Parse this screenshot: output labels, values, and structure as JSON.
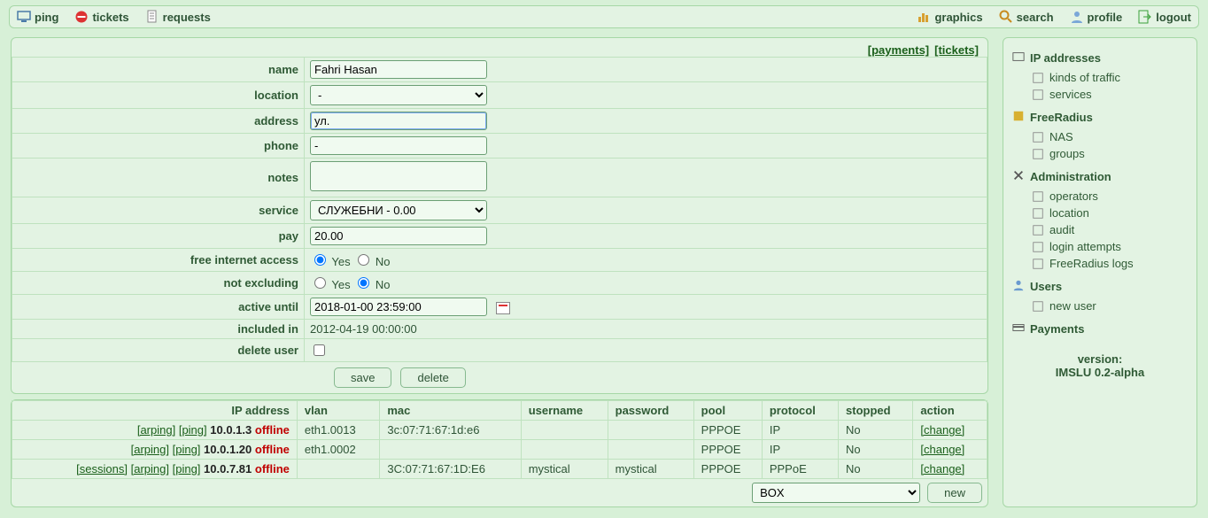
{
  "topbar": {
    "left": [
      {
        "key": "ping",
        "label": "ping"
      },
      {
        "key": "tickets",
        "label": "tickets"
      },
      {
        "key": "requests",
        "label": "requests"
      }
    ],
    "right": [
      {
        "key": "graphics",
        "label": "graphics"
      },
      {
        "key": "search",
        "label": "search"
      },
      {
        "key": "profile",
        "label": "profile"
      },
      {
        "key": "logout",
        "label": "logout"
      }
    ]
  },
  "header_links": {
    "payments": "[payments]",
    "tickets": "[tickets]"
  },
  "form": {
    "name_label": "name",
    "name_value": "Fahri Hasan",
    "location_label": "location",
    "location_value": "-",
    "address_label": "address",
    "address_value": "ул.",
    "phone_label": "phone",
    "phone_value": "-",
    "notes_label": "notes",
    "notes_value": "",
    "service_label": "service",
    "service_value": "СЛУЖЕБНИ - 0.00",
    "pay_label": "pay",
    "pay_value": "20.00",
    "free_label": "free internet access",
    "notexcl_label": "not excluding",
    "yes": "Yes",
    "no": "No",
    "active_label": "active until",
    "active_value": "2018-01-00 23:59:00",
    "included_label": "included in",
    "included_value": "2012-04-19 00:00:00",
    "delete_label": "delete user",
    "save": "save",
    "delete": "delete"
  },
  "ip_table": {
    "headers": {
      "ip": "IP address",
      "vlan": "vlan",
      "mac": "mac",
      "username": "username",
      "password": "password",
      "pool": "pool",
      "protocol": "protocol",
      "stopped": "stopped",
      "action": "action"
    },
    "links": {
      "arping": "[arping]",
      "ping": "[ping]",
      "sessions": "[sessions]",
      "change": "[change]"
    },
    "status": {
      "offline": "offline"
    },
    "rows": [
      {
        "ip": "10.0.1.3",
        "sessions": false,
        "vlan": "eth1.0013",
        "mac": "3c:07:71:67:1d:e6",
        "username": "",
        "password": "",
        "pool": "PPPOE",
        "protocol": "IP",
        "stopped": "No"
      },
      {
        "ip": "10.0.1.20",
        "sessions": false,
        "vlan": "eth1.0002",
        "mac": "",
        "username": "",
        "password": "",
        "pool": "PPPOE",
        "protocol": "IP",
        "stopped": "No"
      },
      {
        "ip": "10.0.7.81",
        "sessions": true,
        "vlan": "",
        "mac": "3C:07:71:67:1D:E6",
        "username": "mystical",
        "password": "mystical",
        "pool": "PPPOE",
        "protocol": "PPPoE",
        "stopped": "No"
      }
    ]
  },
  "bottom": {
    "box": "BOX",
    "new": "new"
  },
  "sidebar": {
    "sections": [
      {
        "title": "IP addresses",
        "items": [
          {
            "label": "kinds of traffic"
          },
          {
            "label": "services"
          }
        ]
      },
      {
        "title": "FreeRadius",
        "items": [
          {
            "label": "NAS"
          },
          {
            "label": "groups"
          }
        ]
      },
      {
        "title": "Administration",
        "items": [
          {
            "label": "operators"
          },
          {
            "label": "location"
          },
          {
            "label": "audit"
          },
          {
            "label": "login attempts"
          },
          {
            "label": "FreeRadius logs"
          }
        ]
      },
      {
        "title": "Users",
        "items": [
          {
            "label": "new user"
          }
        ]
      },
      {
        "title": "Payments",
        "items": []
      }
    ],
    "version_label": "version:",
    "version_value": "IMSLU 0.2-alpha"
  }
}
